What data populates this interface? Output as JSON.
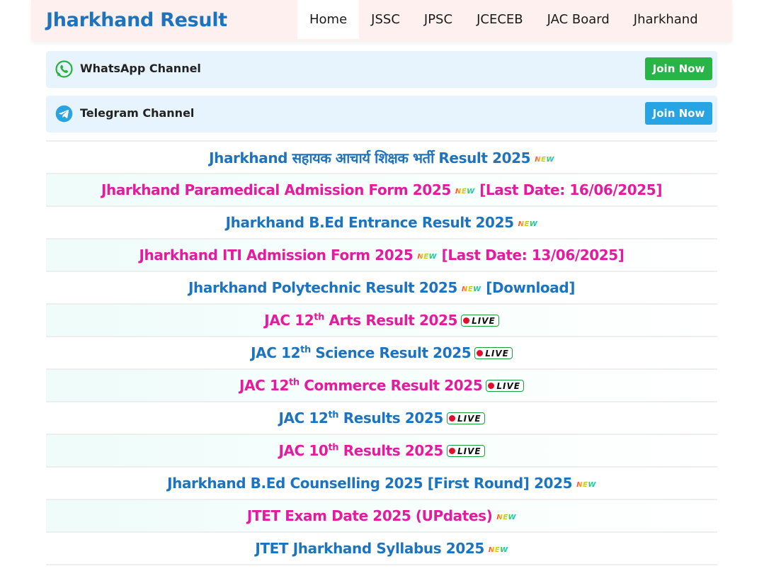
{
  "site": {
    "logo": "Jharkhand Result"
  },
  "nav": {
    "items": [
      {
        "label": "Home",
        "active": true
      },
      {
        "label": "JSSC"
      },
      {
        "label": "JPSC"
      },
      {
        "label": "JCECEB"
      },
      {
        "label": "JAC Board"
      },
      {
        "label": "Jharkhand"
      }
    ]
  },
  "channels": {
    "whatsapp": {
      "label": "WhatsApp Channel",
      "button": "Join Now",
      "color": "#28b446",
      "icon": "whatsapp-icon"
    },
    "telegram": {
      "label": "Telegram Channel",
      "button": "Join Now",
      "color": "#26a4e3",
      "icon": "telegram-icon"
    }
  },
  "badges": {
    "new": "NEW",
    "live": "LIVE"
  },
  "links": [
    {
      "color": "blue",
      "text": "Jharkhand सहायक आचार्य शिक्षक भर्ती Result 2025",
      "badge": "new",
      "suffix": ""
    },
    {
      "color": "pink",
      "text": "Jharkhand Paramedical Admission Form 2025",
      "badge": "new",
      "suffix": "[Last Date: 16/06/2025]"
    },
    {
      "color": "blue",
      "text": "Jharkhand B.Ed Entrance Result 2025",
      "badge": "new",
      "suffix": ""
    },
    {
      "color": "pink",
      "text": "Jharkhand ITI Admission Form 2025",
      "badge": "new",
      "suffix": "[Last Date: 13/06/2025]"
    },
    {
      "color": "blue",
      "text": "Jharkhand Polytechnic Result 2025",
      "badge": "new",
      "suffix": "[Download]"
    },
    {
      "color": "pink",
      "pre": "JAC 12",
      "sup": "th",
      "text": "Arts Result 2025",
      "badge": "live",
      "suffix": ""
    },
    {
      "color": "blue",
      "pre": "JAC 12",
      "sup": "th",
      "text": "Science Result 2025",
      "badge": "live",
      "suffix": ""
    },
    {
      "color": "pink",
      "pre": "JAC 12",
      "sup": "th",
      "text": "Commerce Result 2025",
      "badge": "live",
      "suffix": ""
    },
    {
      "color": "blue",
      "pre": "JAC 12",
      "sup": "th",
      "text": "Results 2025",
      "badge": "live",
      "suffix": ""
    },
    {
      "color": "pink",
      "pre": "JAC 10",
      "sup": "th",
      "text": "Results 2025",
      "badge": "live",
      "suffix": ""
    },
    {
      "color": "blue",
      "text": "Jharkhand B.Ed Counselling 2025 [First Round] 2025",
      "badge": "new",
      "suffix": ""
    },
    {
      "color": "pink",
      "text": "JTET Exam Date 2025 (UPdates)",
      "badge": "new",
      "suffix": ""
    },
    {
      "color": "blue",
      "text": "JTET Jharkhand Syllabus 2025",
      "badge": "new",
      "suffix": ""
    }
  ]
}
